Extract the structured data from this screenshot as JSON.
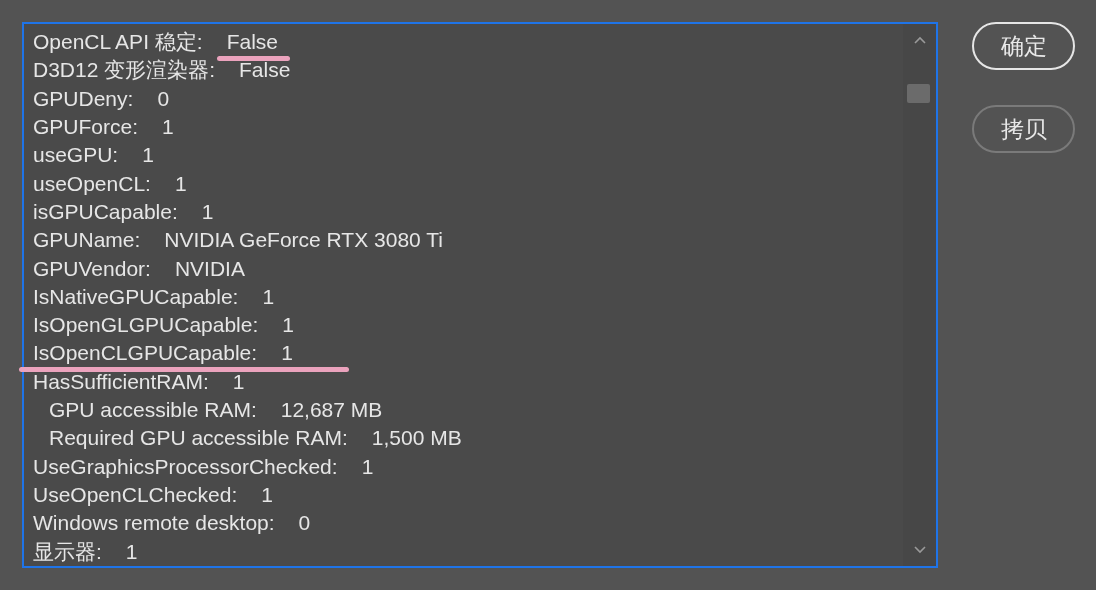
{
  "info_lines": [
    {
      "label": "OpenCL API 稳定:",
      "value": "False",
      "value_underlined": true
    },
    {
      "label": "D3D12 变形渲染器:",
      "value": "False"
    },
    {
      "label": "GPUDeny:",
      "value": "0"
    },
    {
      "label": "GPUForce:",
      "value": "1"
    },
    {
      "label": "useGPU:",
      "value": "1"
    },
    {
      "label": "useOpenCL:",
      "value": "1"
    },
    {
      "label": "isGPUCapable:",
      "value": "1"
    },
    {
      "label": "GPUName:",
      "value": "NVIDIA GeForce RTX 3080 Ti"
    },
    {
      "label": "GPUVendor:",
      "value": "NVIDIA"
    },
    {
      "label": "IsNativeGPUCapable:",
      "value": "1"
    },
    {
      "label": "IsOpenGLGPUCapable:",
      "value": "1"
    },
    {
      "label": "IsOpenCLGPUCapable:",
      "value": "1",
      "row_underlined": true
    },
    {
      "label": "HasSufficientRAM:",
      "value": "1",
      "children": [
        {
          "label": "GPU accessible RAM:",
          "value": "12,687 MB"
        },
        {
          "label": "Required GPU accessible RAM:",
          "value": "1,500 MB"
        }
      ]
    },
    {
      "label": "UseGraphicsProcessorChecked:",
      "value": "1"
    },
    {
      "label": "UseOpenCLChecked:",
      "value": "1"
    },
    {
      "label": "Windows remote desktop:",
      "value": "0"
    },
    {
      "label": "显示器:",
      "value": "1"
    }
  ],
  "buttons": [
    {
      "label": "确定",
      "default": true
    },
    {
      "label": "拷贝",
      "default": false
    }
  ]
}
